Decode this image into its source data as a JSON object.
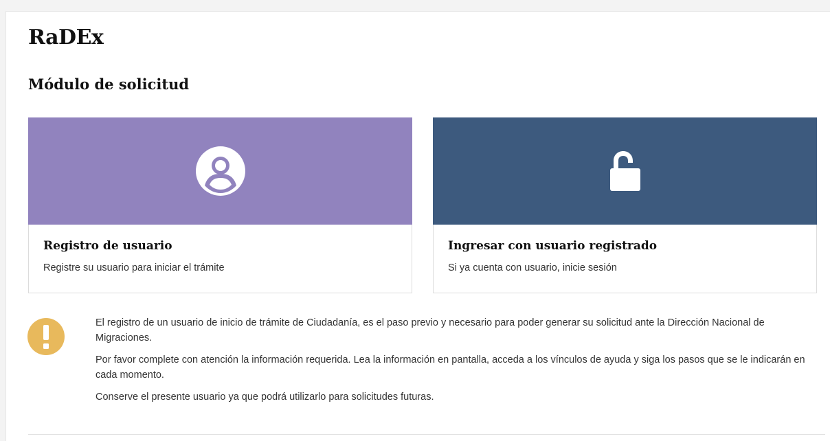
{
  "app": {
    "title": "RaDEx"
  },
  "section": {
    "title": "Módulo de solicitud"
  },
  "cards": [
    {
      "title": "Registro de usuario",
      "description": "Registre su usuario para iniciar el trámite",
      "icon": "user-circle-icon",
      "color": "#9183be"
    },
    {
      "title": "Ingresar con usuario registrado",
      "description": "Si ya cuenta con usuario, inicie sesión",
      "icon": "unlock-icon",
      "color": "#3d5a7e"
    }
  ],
  "notice": {
    "icon": "exclamation-icon",
    "color": "#e8b95c",
    "paragraphs": [
      "El registro de un usuario de inicio de trámite de Ciudadanía, es el paso previo y necesario para poder generar su solicitud ante la Dirección Nacional de Migraciones.",
      "Por favor complete con atención la información requerida. Lea la información en pantalla, acceda a los vínculos de ayuda y siga los pasos que se le indicarán en cada momento.",
      "Conserve el presente usuario ya que podrá utilizarlo para solicitudes futuras."
    ]
  }
}
